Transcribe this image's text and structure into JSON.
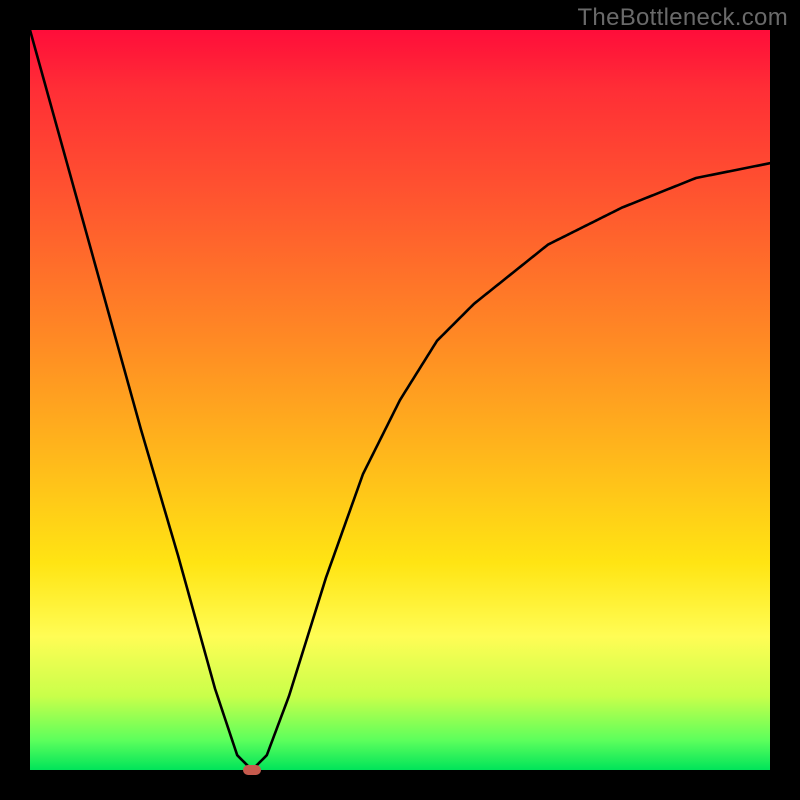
{
  "watermark": "TheBottleneck.com",
  "chart_data": {
    "type": "line",
    "title": "",
    "xlabel": "",
    "ylabel": "",
    "xlim": [
      0,
      100
    ],
    "ylim": [
      0,
      100
    ],
    "grid": false,
    "legend": false,
    "series": [
      {
        "name": "curve",
        "mode": "lines",
        "x": [
          0,
          5,
          10,
          15,
          20,
          25,
          28,
          30,
          32,
          35,
          40,
          45,
          50,
          55,
          60,
          70,
          80,
          90,
          100
        ],
        "y": [
          100,
          82,
          64,
          46,
          29,
          11,
          2,
          0,
          2,
          10,
          26,
          40,
          50,
          58,
          63,
          71,
          76,
          80,
          82
        ]
      }
    ],
    "markers": [
      {
        "name": "min-point",
        "x": 30,
        "y": 0,
        "color": "#c65a4d"
      }
    ],
    "background_gradient": {
      "direction": "vertical",
      "stops": [
        {
          "pos": 0.0,
          "color": "#ff0d3a"
        },
        {
          "pos": 0.5,
          "color": "#ffb000"
        },
        {
          "pos": 0.8,
          "color": "#fff030"
        },
        {
          "pos": 1.0,
          "color": "#00e060"
        }
      ]
    }
  }
}
